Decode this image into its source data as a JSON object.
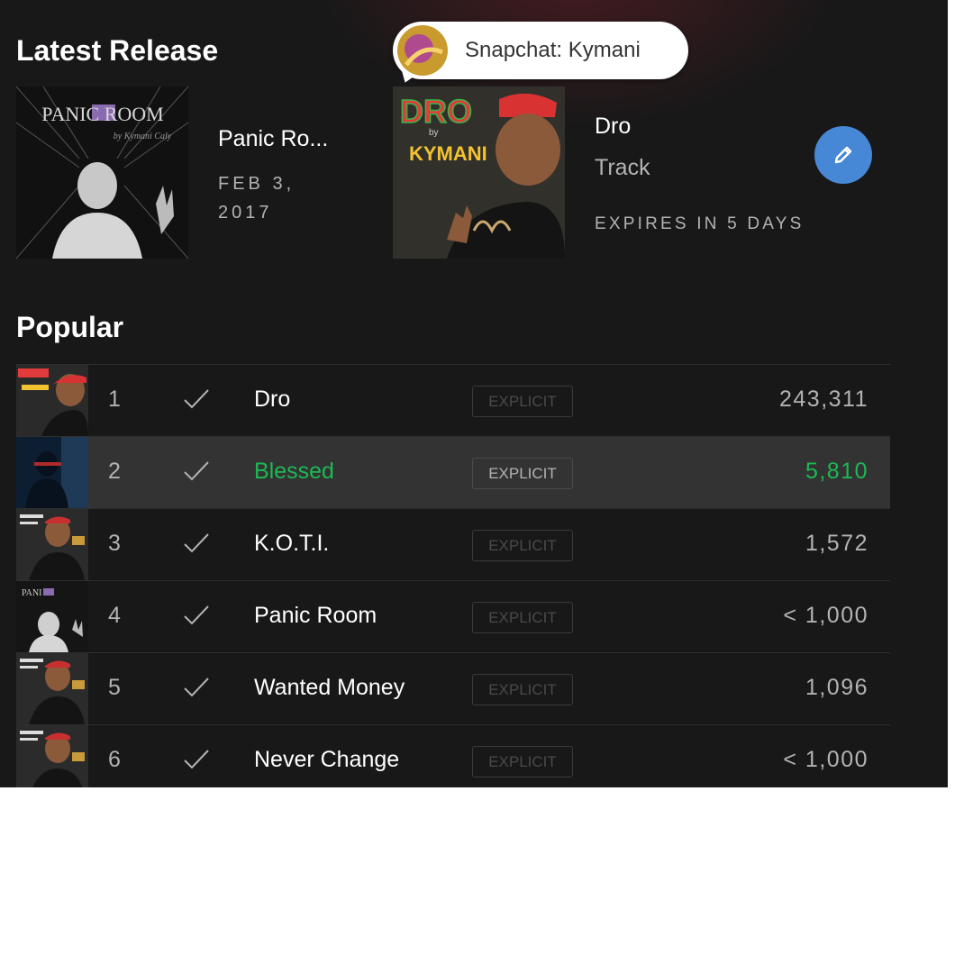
{
  "latest_release": {
    "heading": "Latest Release",
    "album": {
      "title": "Panic Ro...",
      "date": "FEB 3, 2017",
      "cover_text": "PANIC ROOM",
      "cover_subtext": "by Kymani Caly"
    },
    "promo": {
      "title": "Dro",
      "type": "Track",
      "expires": "EXPIRES IN 5 DAYS",
      "cover_title": "DRO",
      "cover_by": "by",
      "cover_artist": "KYMANI"
    }
  },
  "tooltip": {
    "label": "Snapchat: Kymani"
  },
  "popular": {
    "heading": "Popular",
    "tracks": [
      {
        "num": "1",
        "name": "Dro",
        "explicit": "EXPLICIT",
        "plays": "243,311",
        "active": false
      },
      {
        "num": "2",
        "name": "Blessed",
        "explicit": "EXPLICIT",
        "plays": "5,810",
        "active": true
      },
      {
        "num": "3",
        "name": "K.O.T.I.",
        "explicit": "EXPLICIT",
        "plays": "1,572",
        "active": false
      },
      {
        "num": "4",
        "name": "Panic Room",
        "explicit": "EXPLICIT",
        "plays": "< 1,000",
        "active": false
      },
      {
        "num": "5",
        "name": "Wanted Money",
        "explicit": "EXPLICIT",
        "plays": "1,096",
        "active": false
      },
      {
        "num": "6",
        "name": "Never Change",
        "explicit": "EXPLICIT",
        "plays": "< 1,000",
        "active": false
      }
    ]
  },
  "colors": {
    "background": "#181818",
    "accent_green": "#1db954",
    "edit_button": "#4687d6",
    "text_muted": "#b3b3b3"
  },
  "icons": {
    "check": "check-icon",
    "edit": "pencil-icon"
  }
}
